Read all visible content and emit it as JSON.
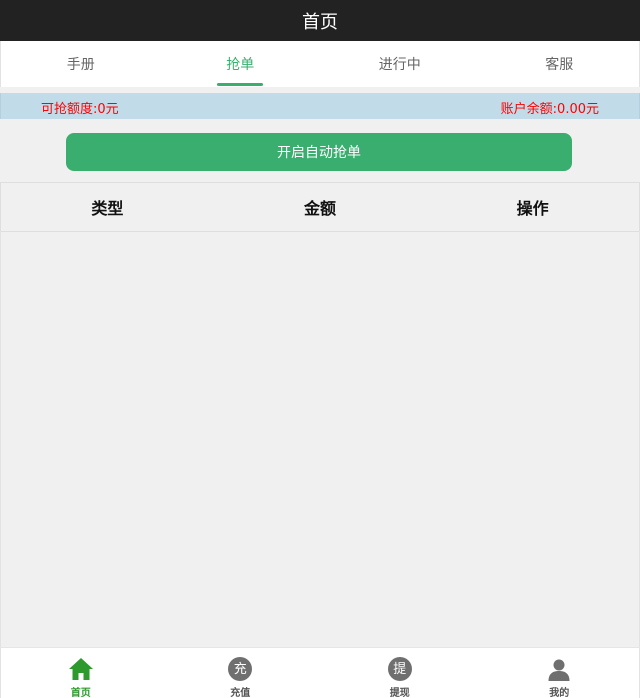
{
  "header": {
    "title": "首页"
  },
  "tabs": [
    {
      "label": "手册",
      "active": false
    },
    {
      "label": "抢单",
      "active": true
    },
    {
      "label": "进行中",
      "active": false
    },
    {
      "label": "客服",
      "active": false
    }
  ],
  "quota": {
    "grab_limit": "可抢额度:0元",
    "balance": "账户余额:0.00元"
  },
  "auto_grab_button": "开启自动抢单",
  "table": {
    "columns": [
      "类型",
      "金额",
      "操作"
    ],
    "rows": []
  },
  "bottom_nav": [
    {
      "label": "首页",
      "icon": "home-icon",
      "active": true
    },
    {
      "label": "充值",
      "icon": "recharge-icon",
      "glyph": "充",
      "active": false
    },
    {
      "label": "提现",
      "icon": "withdraw-icon",
      "glyph": "提",
      "active": false
    },
    {
      "label": "我的",
      "icon": "user-icon",
      "active": false
    }
  ],
  "colors": {
    "accent": "#3aae6e",
    "title_bar": "#222222",
    "quota_bg": "#c2dbe9",
    "quota_text": "#ff0000",
    "nav_active": "#2e9a2e"
  }
}
